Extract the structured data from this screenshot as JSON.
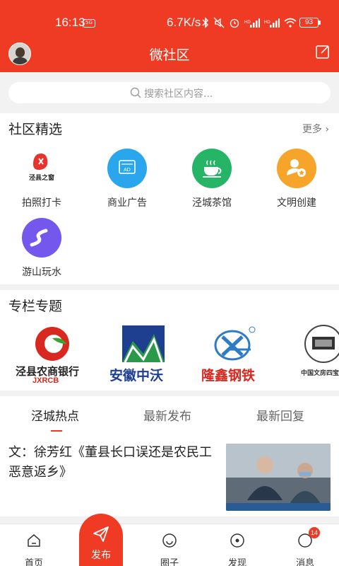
{
  "status_bar": {
    "time": "16:13",
    "small_badge": "5G",
    "network_speed": "6.7K/s",
    "battery": "93",
    "icons": [
      "bluetooth-icon",
      "mute-icon",
      "alarm-icon",
      "signal-icon",
      "signal-icon",
      "wifi-icon"
    ]
  },
  "header": {
    "title": "微社区"
  },
  "search": {
    "placeholder": "搜索社区内容..."
  },
  "community": {
    "title": "社区精选",
    "more": "更多",
    "items": [
      {
        "label": "拍照打卡",
        "logo_text": "泾县之窗",
        "color": "#ffffff"
      },
      {
        "label": "商业广告",
        "badge": "AD",
        "color": "#2aa7ec"
      },
      {
        "label": "泾城茶馆",
        "color": "#26b466"
      },
      {
        "label": "文明创建",
        "color": "#f7a52a"
      },
      {
        "label": "游山玩水",
        "color": "#7457ec"
      }
    ]
  },
  "columns": {
    "title": "专栏专题",
    "logos": [
      {
        "name": "泾县农商银行",
        "sub": "JXRCB"
      },
      {
        "name": "安徽中沃"
      },
      {
        "name": "隆鑫钢铁"
      },
      {
        "name": "中国文房四宝"
      }
    ]
  },
  "feed": {
    "tabs": [
      "泾城热点",
      "最新发布",
      "最新回复"
    ],
    "active_tab": 0,
    "article": {
      "title": "文：徐芳红《董县长口误还是农民工恶意返乡》"
    }
  },
  "bottom_nav": {
    "items": [
      "首页",
      "发布",
      "圈子",
      "发现",
      "消息"
    ],
    "message_count": "14"
  },
  "colors": {
    "brand": "#ef3b24",
    "background": "#f2f2f2"
  }
}
